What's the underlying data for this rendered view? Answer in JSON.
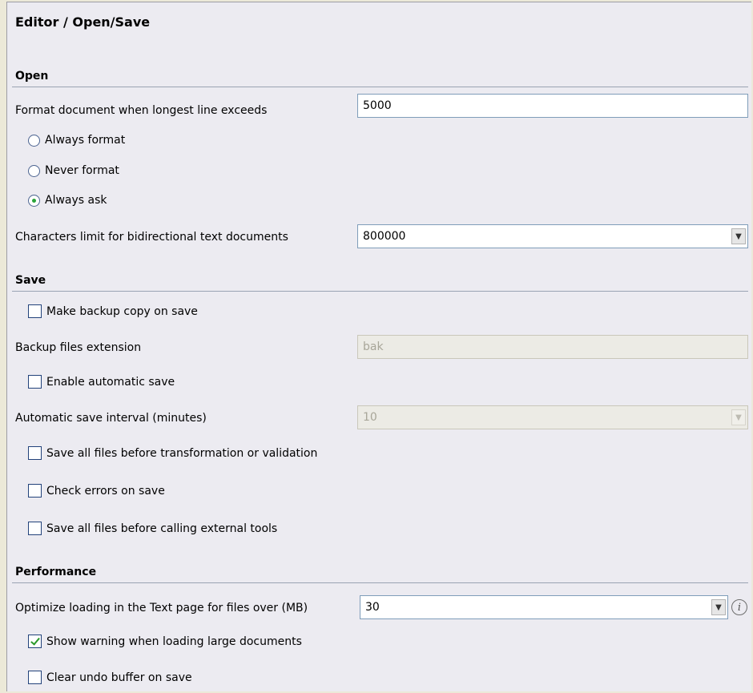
{
  "title": "Editor / Open/Save",
  "open": {
    "heading": "Open",
    "format_label": "Format document when longest line exceeds",
    "format_value": "5000",
    "radio_always": "Always format",
    "radio_never": "Never format",
    "radio_ask": "Always ask",
    "selected_radio": "Always ask",
    "bidi_label": "Characters limit for bidirectional text documents",
    "bidi_value": "800000"
  },
  "save": {
    "heading": "Save",
    "backup_label": "Make backup copy on save",
    "backup_checked": false,
    "backup_ext_label": "Backup files extension",
    "backup_ext_value": "bak",
    "autosave_label": "Enable automatic save",
    "autosave_checked": false,
    "autosave_interval_label": "Automatic save interval (minutes)",
    "autosave_interval_value": "10",
    "save_before_transform_label": "Save all files before transformation or validation",
    "check_errors_label": "Check errors on save",
    "save_before_tools_label": "Save all files before calling external tools"
  },
  "performance": {
    "heading": "Performance",
    "optimize_label": "Optimize loading in the Text page for files over (MB)",
    "optimize_value": "30",
    "warning_label": "Show warning when loading large documents",
    "warning_checked": true,
    "clear_undo_label": "Clear undo buffer on save",
    "clear_undo_checked": false
  },
  "icons": {
    "combo_arrow": "chevron-down-icon",
    "info": "info-icon"
  }
}
